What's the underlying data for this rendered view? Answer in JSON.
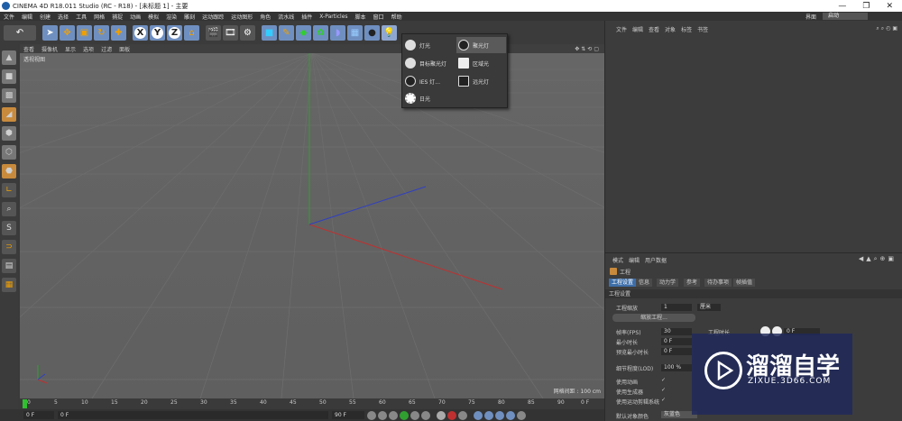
{
  "window": {
    "title": "CINEMA 4D R18.011 Studio (RC - R18) - [未标题 1] - 主要",
    "minimize": "—",
    "maximize": "❐",
    "close": "✕"
  },
  "menubar": {
    "items": [
      "文件",
      "编辑",
      "创建",
      "选择",
      "工具",
      "网格",
      "捕捉",
      "动画",
      "模拟",
      "渲染",
      "雕刻",
      "运动跟踪",
      "运动图形",
      "角色",
      "流水线",
      "插件",
      "X-Particles",
      "脚本",
      "窗口",
      "帮助"
    ],
    "layout_label": "界面",
    "layout_value": "启动"
  },
  "toolbar": {
    "icons": [
      "undo-icon",
      "select-arrow-icon",
      "move-icon",
      "scale-icon",
      "rotate-icon",
      "add-icon",
      "x-axis-icon",
      "y-axis-icon",
      "z-axis-icon",
      "coord-icon",
      "render-view-icon",
      "render-picture-icon",
      "render-settings-icon",
      "cube-icon",
      "pen-icon",
      "subdivision-icon",
      "cloner-icon",
      "deformer-icon",
      "floor-icon",
      "camera-icon",
      "light-icon"
    ],
    "x": "X",
    "y": "Y",
    "z": "Z"
  },
  "viewport": {
    "menu": [
      "查看",
      "摄像机",
      "显示",
      "选项",
      "过滤",
      "面板"
    ],
    "label": "透视视图",
    "grid_info": "网格间距 : 100 cm"
  },
  "light_popup": {
    "items": [
      {
        "label": "灯光",
        "col": 0
      },
      {
        "label": "聚光灯",
        "col": 1
      },
      {
        "label": "目标聚光灯",
        "col": 0
      },
      {
        "label": "区域光",
        "col": 1
      },
      {
        "label": "IES 灯...",
        "col": 0
      },
      {
        "label": "远光灯",
        "col": 1
      },
      {
        "label": "日光",
        "col": 0
      }
    ]
  },
  "timeline": {
    "ticks": [
      "0",
      "5",
      "10",
      "15",
      "20",
      "25",
      "30",
      "35",
      "40",
      "45",
      "50",
      "55",
      "60",
      "65",
      "70",
      "75",
      "80",
      "85",
      "90"
    ],
    "end_frame": "0 F",
    "start_field": "0 F",
    "current_field": "0 F",
    "end_field": "90 F"
  },
  "object_manager": {
    "menu": [
      "文件",
      "编辑",
      "查看",
      "对象",
      "标签",
      "书签"
    ]
  },
  "attribute_manager": {
    "menu": [
      "模式",
      "编辑",
      "用户数据"
    ],
    "title": "工程",
    "tabs": [
      "工程设置",
      "信息",
      "动力学",
      "参考",
      "待办事项",
      "帧插值"
    ],
    "section": "工程设置",
    "fields": {
      "scale_label": "工程缩放",
      "scale_value": "1",
      "scale_unit": "厘米",
      "scale_button": "缩放工程...",
      "fps_label": "帧率(FPS)",
      "fps_value": "30",
      "project_time_label": "工程时长",
      "project_time_value": "0 F",
      "min_time_label": "最小时长",
      "min_time_value": "0 F",
      "preview_min_label": "预览最小时长",
      "preview_min_value": "0 F",
      "lod_label": "细节程度(LOD)",
      "lod_value": "100 %",
      "use_anim": "使用动画",
      "use_gen": "使用生成器",
      "use_motion": "使用运动剪辑系统",
      "default_color_label": "默认对象颜色",
      "default_color_value": "灰蓝色"
    }
  },
  "watermark": {
    "brand": "溜溜自学",
    "url": "ZIXUE.3D66.COM"
  },
  "colors": {
    "accent_blue": "#3e6ea8",
    "axis_x": "#c03030",
    "axis_y": "#30a030",
    "axis_z": "#3040c0"
  }
}
